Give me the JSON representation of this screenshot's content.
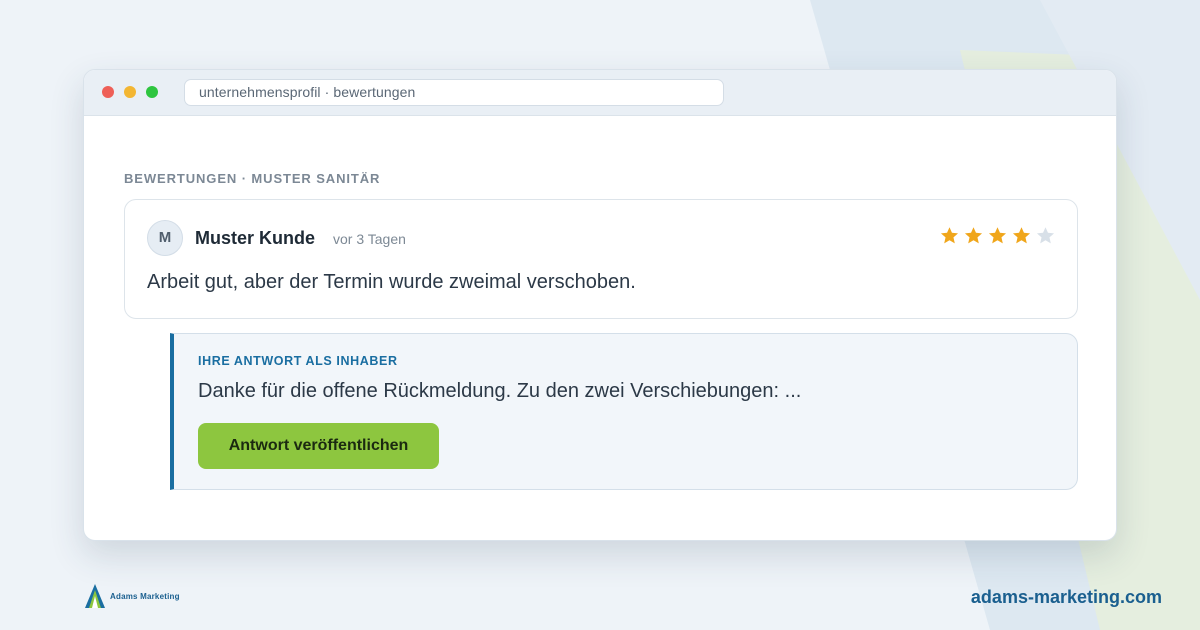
{
  "colors": {
    "page_background": "#eef3f8",
    "accent": "#1a6ea1",
    "button": "#8dc63f",
    "star_filled": "#f0a61b",
    "star_empty": "#d8e0e8",
    "dot_red": "#ee5f57",
    "dot_yellow": "#f3b632",
    "dot_green": "#2ec53f"
  },
  "window": {
    "url": "unternehmensprofil · bewertungen"
  },
  "section": {
    "label": "BEWERTUNGEN · MUSTER SANITÄR"
  },
  "review": {
    "avatar_initial": "M",
    "reviewer_name": "Muster Kunde",
    "time_ago": "vor 3 Tagen",
    "rating": 4,
    "rating_max": 5,
    "text": "Arbeit gut, aber der Termin wurde zweimal verschoben."
  },
  "reply": {
    "label": "IHRE ANTWORT ALS INHABER",
    "text": "Danke für die offene Rückmeldung. Zu den zwei Verschiebungen: ...",
    "publish_button": "Antwort veröffentlichen"
  },
  "footer": {
    "logo_text": "Adams Marketing",
    "url": "adams-marketing.com"
  }
}
